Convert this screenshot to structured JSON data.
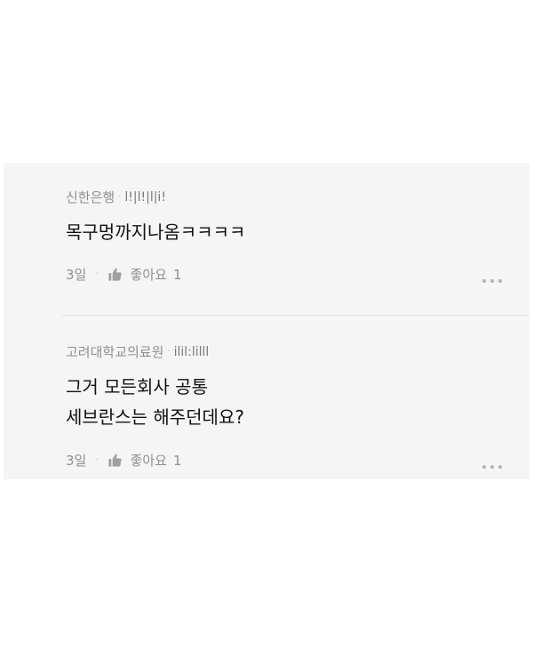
{
  "comments": [
    {
      "author": "신한은행",
      "masked_id": "l!|l!|l|i!",
      "body_lines": [
        "목구멍까지나옴ㅋㅋㅋㅋ"
      ],
      "time": "3일",
      "like_label": "좋아요",
      "like_count": "1"
    },
    {
      "author": "고려대학교의료원",
      "masked_id": "ilil:lilll",
      "body_lines": [
        "그거 모든회사 공통",
        "세브란스는 해주던데요?"
      ],
      "time": "3일",
      "like_label": "좋아요",
      "like_count": "1"
    }
  ],
  "separator": "·",
  "icons": {
    "like": "thumbs-up-icon",
    "more": "more-dots-icon"
  },
  "colors": {
    "panel_bg": "#f5f5f5",
    "meta_text": "#8f8f8f",
    "body_text": "#111111"
  }
}
